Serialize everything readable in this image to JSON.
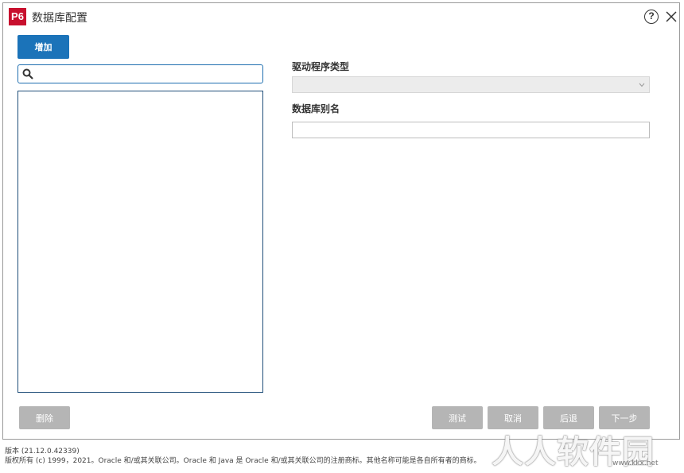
{
  "window": {
    "logo_text": "P6",
    "title": "数据库配置",
    "help_label": "?"
  },
  "toolbar": {
    "add_label": "增加"
  },
  "search": {
    "value": "",
    "placeholder": ""
  },
  "form": {
    "driver_type_label": "驱动程序类型",
    "driver_type_value": "",
    "db_alias_label": "数据库别名",
    "db_alias_value": ""
  },
  "buttons": {
    "delete_label": "删除",
    "test_label": "测试",
    "cancel_label": "取消",
    "back_label": "后退",
    "next_label": "下一步"
  },
  "footer": {
    "version": "版本 (21.12.0.42339)",
    "copyright": "版权所有 (c) 1999，2021。Oracle 和/或其关联公司。Oracle 和 Java 是 Oracle 和/或其关联公司的注册商标。其他名称可能是各自所有者的商标。"
  },
  "watermark": {
    "text": "人人软件园",
    "url": "www.kkx.net"
  },
  "colors": {
    "brand": "#c8102e",
    "primary_button": "#1b73b9",
    "disabled_button": "#b5b5b5",
    "list_border": "#1f4e79"
  },
  "icons": [
    "p6-logo",
    "help-icon",
    "close-icon",
    "search-icon",
    "chevron-down-icon"
  ]
}
